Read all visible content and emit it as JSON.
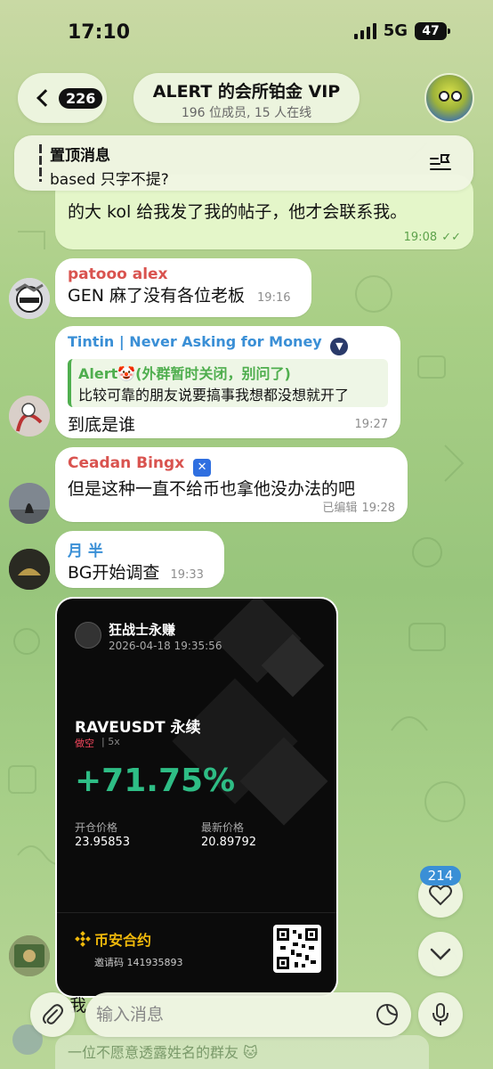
{
  "status": {
    "time": "17:10",
    "network": "5G",
    "battery": "47"
  },
  "header": {
    "unread_count": "226",
    "title": "ALERT 的会所铂金 VIP",
    "subtitle": "196 位成员, 15 人在线"
  },
  "pinned": {
    "label": "置顶消息",
    "text": "based 只字不提?"
  },
  "messages": [
    {
      "text": "的大 kol 给我发了我的帖子，他才会联系我。",
      "time": "19:08"
    },
    {
      "sender": "patooo alex",
      "sender_color": "#d9534f",
      "text": "GEN 麻了没有各位老板",
      "time": "19:16"
    },
    {
      "sender": "Tintin | Never Asking for Money",
      "sender_color": "#3a8fd6",
      "reply_name": "Alert🤡(外群暂时关闭，别问了)",
      "reply_text": "比较可靠的朋友说要搞事我想都没想就开了",
      "text": "到底是谁",
      "time": "19:27"
    },
    {
      "sender": "Ceadan Bingx",
      "sender_color": "#d9534f",
      "text": "但是这种一直不给币也拿他没办法的吧",
      "time": "19:28",
      "edited": "已编辑"
    },
    {
      "sender": "月 半",
      "sender_color": "#3a8fd6",
      "text": "BG开始调查",
      "time": "19:33"
    }
  ],
  "card": {
    "user": "狂战士永赚",
    "date": "2026-04-18 19:35:56",
    "pair": "RAVEUSDT 永续",
    "side": "做空",
    "leverage": "5x",
    "pnl": "+71.75%",
    "open_label": "开仓价格",
    "open_price": "23.95853",
    "last_label": "最新价格",
    "last_price": "20.89792",
    "brand": "币安合约",
    "ref": "邀请码 141935893"
  },
  "reaction_count": "214",
  "input": {
    "placeholder": "输入消息"
  },
  "preview": {
    "text": "一位不愿意透露姓名的群友 🐱",
    "partial_char": "我"
  },
  "icons": {
    "back": "chevron-left-icon",
    "pinned_list": "pin-list-icon",
    "heart": "heart-icon",
    "scroll_down": "chevron-down-icon",
    "attach": "paperclip-icon",
    "sticker": "sticker-icon",
    "mic": "microphone-icon"
  }
}
